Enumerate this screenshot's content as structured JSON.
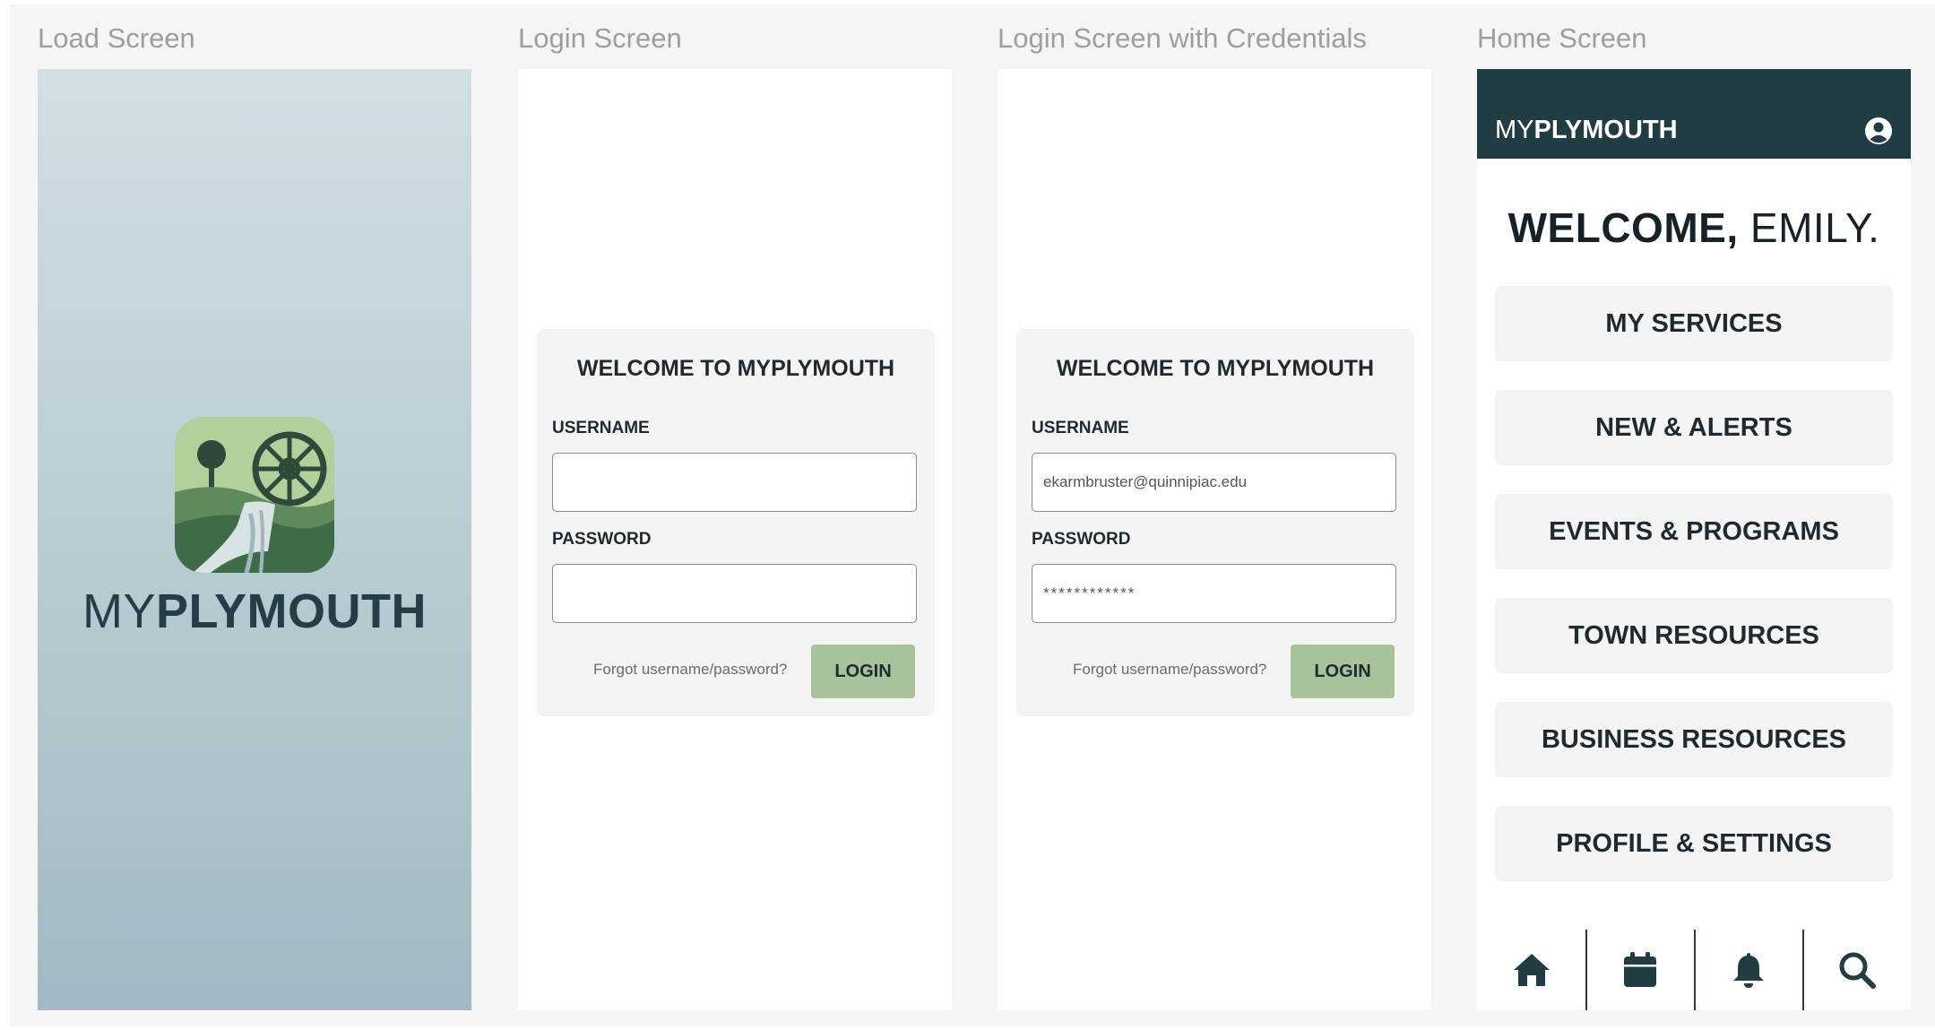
{
  "frames": {
    "load": {
      "label": "Load Screen"
    },
    "login": {
      "label": "Login Screen"
    },
    "login_credentials": {
      "label": "Login Screen with Credentials"
    },
    "home": {
      "label": "Home Screen"
    }
  },
  "brand": {
    "prefix": "MY",
    "name": "PLYMOUTH"
  },
  "login": {
    "title": "WELCOME TO MYPLYMOUTH",
    "username_label": "USERNAME",
    "password_label": "PASSWORD",
    "forgot_text": "Forgot username/password?",
    "login_button": "LOGIN",
    "empty": {
      "username": "",
      "password": ""
    },
    "filled": {
      "username": "ekarmbruster@quinnipiac.edu",
      "password": "************"
    }
  },
  "home": {
    "welcome_bold": "WELCOME,",
    "welcome_name": "EMILY.",
    "menu": [
      "MY SERVICES",
      "NEW & ALERTS",
      "EVENTS & PROGRAMS",
      "TOWN RESOURCES",
      "BUSINESS RESOURCES",
      "PROFILE & SETTINGS"
    ],
    "tabs": [
      "home-icon",
      "calendar-icon",
      "bell-icon",
      "search-icon"
    ]
  },
  "colors": {
    "header": "#223c44",
    "login_button": "#a8c39b",
    "load_gradient_top": "#d2dfe3",
    "load_gradient_bottom": "#a2b9c3"
  }
}
